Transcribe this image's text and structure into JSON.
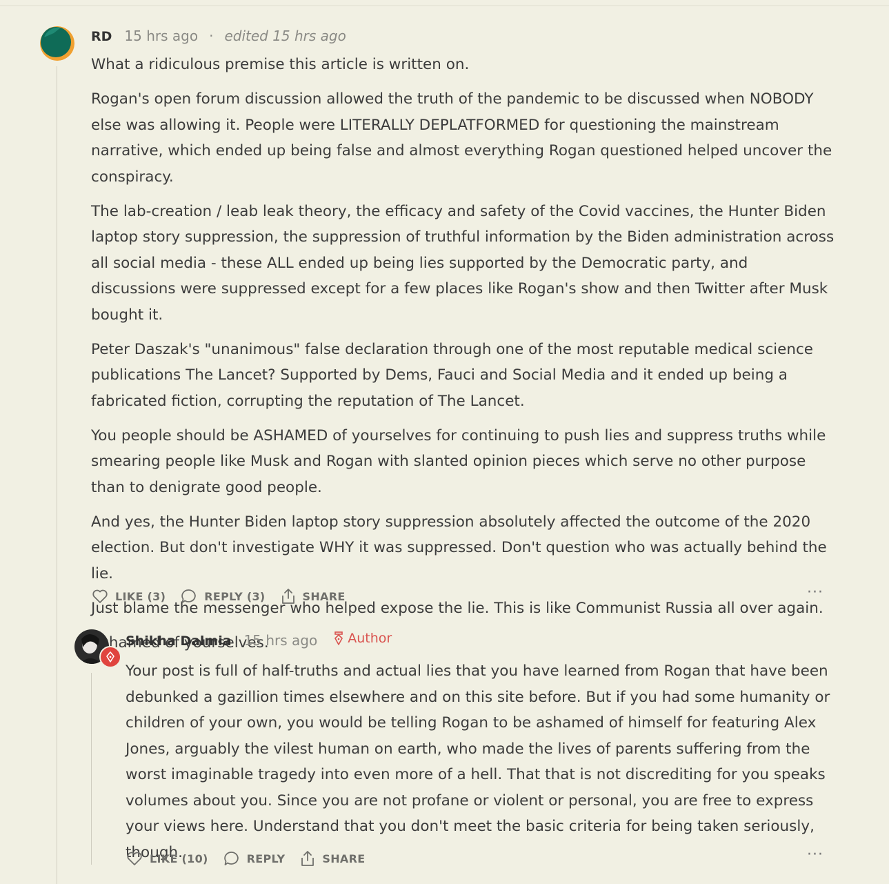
{
  "comments": [
    {
      "author": "RD",
      "time": "15 hrs ago",
      "separator": "·",
      "edited": "edited 15 hrs ago",
      "paragraphs": [
        "What a ridiculous premise this article is written on.",
        "Rogan's open forum discussion allowed the truth of the pandemic to be discussed when NOBODY else was allowing it. People were LITERALLY DEPLATFORMED for questioning the mainstream narrative, which ended up being false and almost everything Rogan questioned helped uncover the conspiracy.",
        "The lab-creation / leab leak theory, the efficacy and safety of the Covid vaccines, the Hunter Biden laptop story suppression, the suppression of truthful information by the Biden administration across all social media - these ALL ended up being lies supported by the Democratic party, and discussions were suppressed except for a few places like Rogan's show and then Twitter after Musk bought it.",
        "Peter Daszak's \"unanimous\" false declaration through one of the most reputable medical science publications The Lancet? Supported by Dems, Fauci and Social Media and it ended up being a fabricated fiction, corrupting the reputation of The Lancet.",
        "You people should be ASHAMED of yourselves for continuing to push lies and suppress truths while smearing people like Musk and Rogan with slanted opinion pieces which serve no other purpose than to denigrate good people.",
        "And yes, the Hunter Biden laptop story suppression absolutely affected the outcome of the 2020 election. But don't investigate WHY it was suppressed. Don't question who was actually behind the lie.",
        "Just blame the messenger who helped expose the lie. This is like Communist Russia all over again.",
        "Ashamed of yourselves."
      ],
      "actions": {
        "like": "LIKE (3)",
        "reply": "REPLY (3)",
        "share": "SHARE",
        "more": "···"
      }
    },
    {
      "author": "Shikha Dalmia",
      "time": "15 hrs ago",
      "badge": "Author",
      "paragraphs": [
        "Your post is full of half-truths and actual lies that you have learned from Rogan that have been debunked a gazillion times elsewhere and on this site before. But if you had some humanity or children of your own, you would be telling Rogan to be ashamed of himself for featuring Alex Jones, arguably the vilest human on earth, who made the lives of parents suffering from the worst imaginable tragedy into even more of a hell. That that is not discrediting for you speaks volumes about you. Since you are not profane or violent or personal, you are free to express your views here. Understand that you don't meet the basic criteria for being taken seriously, though."
      ],
      "actions": {
        "like": "LIKE (10)",
        "reply": "REPLY",
        "share": "SHARE",
        "more": "···"
      }
    }
  ],
  "colors": {
    "background": "#f1f0e3",
    "author_badge": "#d9534f",
    "avatar_green": "#0f6b57",
    "avatar_orange": "#f0a030"
  },
  "icons": [
    "heart-icon",
    "comment-bubble-icon",
    "share-icon",
    "more-dots-icon",
    "pen-nib-icon"
  ]
}
